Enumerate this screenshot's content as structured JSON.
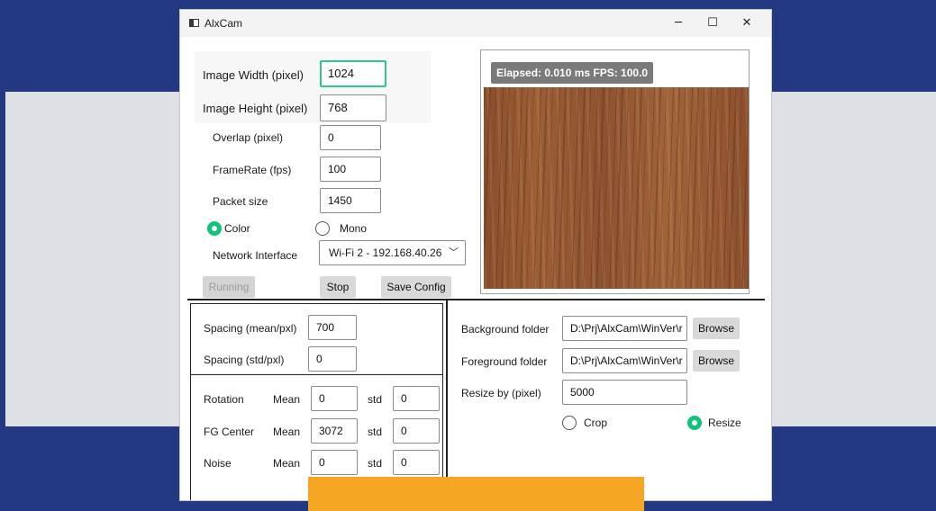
{
  "window": {
    "title": "AlxCam",
    "minimize_glyph": "─",
    "maximize_glyph": "☐",
    "close_glyph": "✕"
  },
  "camera": {
    "image_width_label": "Image Width (pixel)",
    "image_width_value": "1024",
    "image_height_label": "Image Height (pixel)",
    "image_height_value": "768",
    "overlap_label": "Overlap (pixel)",
    "overlap_value": "0",
    "framerate_label": "FrameRate (fps)",
    "framerate_value": "100",
    "packet_size_label": "Packet size",
    "packet_size_value": "1450",
    "color_label": "Color",
    "color_selected": true,
    "mono_label": "Mono",
    "mono_selected": false,
    "network_label": "Network Interface",
    "network_value": "Wi-Fi 2 - 192.168.40.26",
    "running_label": "Running",
    "stop_label": "Stop",
    "save_config_label": "Save Config"
  },
  "preview": {
    "stats_text": "Elapsed: 0.010 ms   FPS: 100.0",
    "image": "wood-texture"
  },
  "spacing": {
    "mean_label": "Spacing (mean/pxl)",
    "mean_value": "700",
    "std_label": "Spacing (std/pxl)",
    "std_value": "0"
  },
  "params": {
    "mean_label": "Mean",
    "std_label": "std",
    "rows": [
      {
        "label": "Rotation",
        "mean": "0",
        "std": "0"
      },
      {
        "label": "FG Center",
        "mean": "3072",
        "std": "0"
      },
      {
        "label": "Noise",
        "mean": "0",
        "std": "0"
      }
    ]
  },
  "folders": {
    "background_label": "Background folder",
    "background_value": "D:\\Prj\\AlxCam\\WinVer\\r",
    "foreground_label": "Foreground folder",
    "foreground_value": "D:\\Prj\\AlxCam\\WinVer\\r",
    "browse_label": "Browse",
    "resize_by_label": "Resize by (pixel)",
    "resize_by_value": "5000",
    "crop_label": "Crop",
    "crop_selected": false,
    "resize_label": "Resize",
    "resize_selected": true
  },
  "colors": {
    "background": "#233a82",
    "accent_green": "#10c27a",
    "overlay_orange": "#f5a623"
  }
}
